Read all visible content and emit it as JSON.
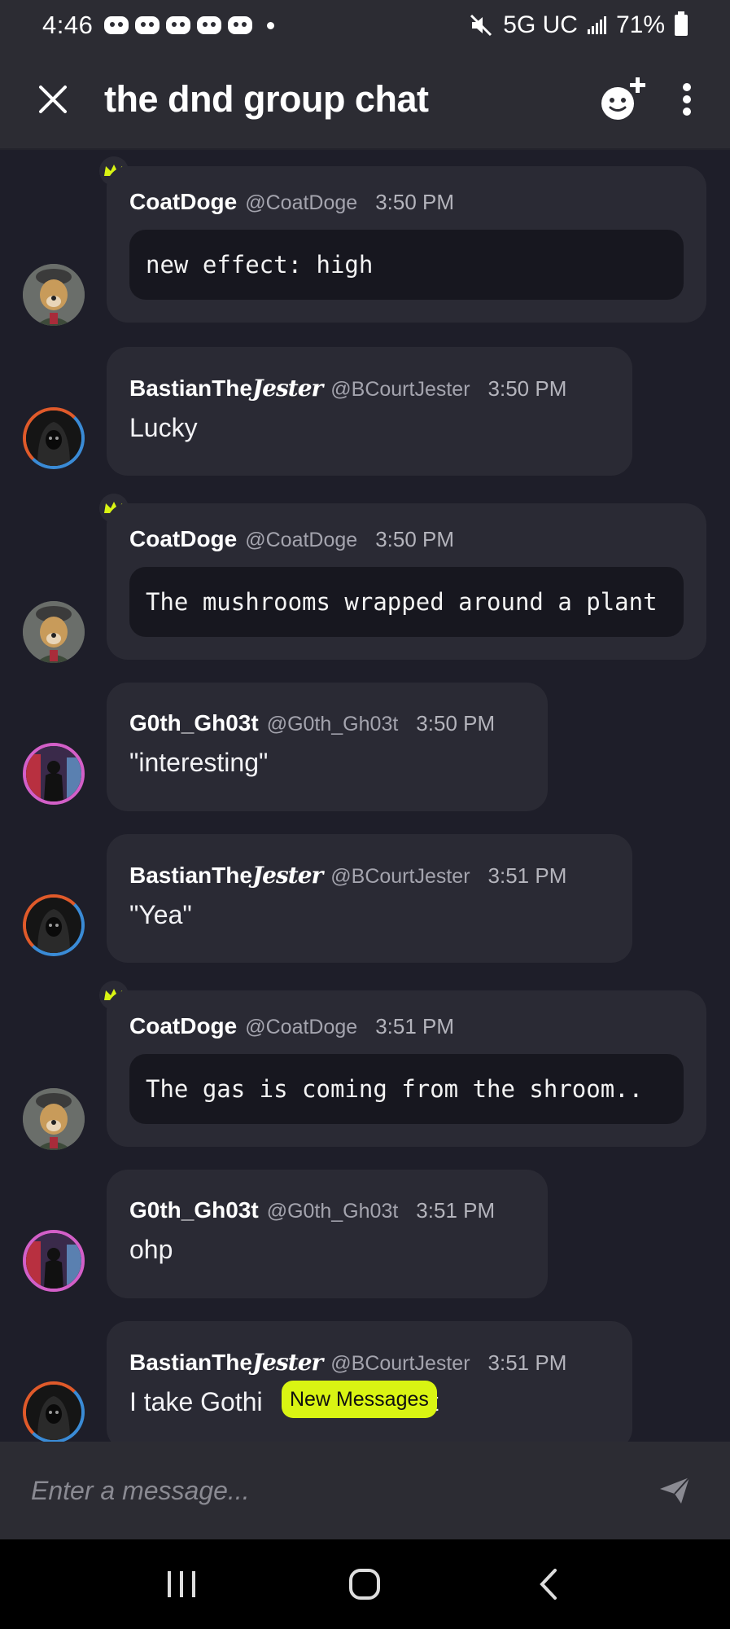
{
  "status_bar": {
    "time": "4:46",
    "network": "5G UC",
    "battery": "71%"
  },
  "header": {
    "title": "the dnd group chat",
    "icons": [
      "close-icon",
      "add-reaction-icon",
      "more-vert-icon"
    ]
  },
  "messages": [
    {
      "author": "CoatDoge",
      "handle": "@CoatDoge",
      "time": "3:50 PM",
      "code": "new effect: high",
      "crown": true
    },
    {
      "author": "BastianTheJester",
      "author_prefix": "BastianThe",
      "author_styled": "Jester",
      "handle": "@BCourtJester",
      "time": "3:50 PM",
      "text": "Lucky"
    },
    {
      "author": "CoatDoge",
      "handle": "@CoatDoge",
      "time": "3:50 PM",
      "code": "The mushrooms wrapped around a plant",
      "crown": true
    },
    {
      "author": "G0th_Gh03t",
      "handle": "@G0th_Gh03t",
      "time": "3:50 PM",
      "text": "\"interesting\""
    },
    {
      "author": "BastianTheJester",
      "author_prefix": "BastianThe",
      "author_styled": "Jester",
      "handle": "@BCourtJester",
      "time": "3:51 PM",
      "text": "\"Yea\""
    },
    {
      "author": "CoatDoge",
      "handle": "@CoatDoge",
      "time": "3:51 PM",
      "code": "The gas is coming from the shroom..",
      "crown": true
    },
    {
      "author": "G0th_Gh03t",
      "handle": "@G0th_Gh03t",
      "time": "3:51 PM",
      "text": "ohp"
    },
    {
      "author": "BastianTheJester",
      "author_prefix": "BastianThe",
      "author_styled": "Jester",
      "handle": "@BCourtJester",
      "time": "3:51 PM",
      "text_start": "I take Gothi",
      "text_end": "it"
    }
  ],
  "new_messages_label": "New Messages",
  "composer": {
    "placeholder": "Enter a message..."
  },
  "colors": {
    "accent": "#d9f413",
    "background": "#1e1e29",
    "bubble": "#2a2a34",
    "code": "#17171f"
  }
}
